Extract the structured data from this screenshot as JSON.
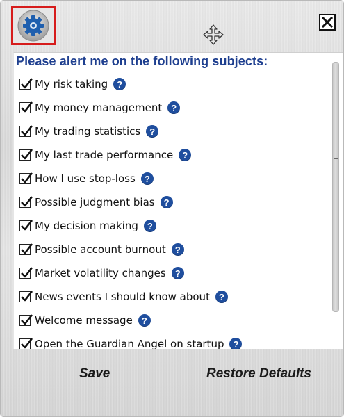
{
  "panel": {
    "title": "Please alert me on the following subjects:"
  },
  "subjects": [
    {
      "label": "My risk taking",
      "checked": true,
      "help": "?"
    },
    {
      "label": "My money management",
      "checked": true,
      "help": "?"
    },
    {
      "label": "My trading statistics",
      "checked": true,
      "help": "?"
    },
    {
      "label": "My last trade performance",
      "checked": true,
      "help": "?"
    },
    {
      "label": "How I use stop-loss",
      "checked": true,
      "help": "?"
    },
    {
      "label": "Possible judgment bias",
      "checked": true,
      "help": "?"
    },
    {
      "label": "My decision making",
      "checked": true,
      "help": "?"
    },
    {
      "label": "Possible account burnout",
      "checked": true,
      "help": "?"
    },
    {
      "label": "Market volatility changes",
      "checked": true,
      "help": "?"
    },
    {
      "label": "News events I should know about",
      "checked": true,
      "help": "?"
    },
    {
      "label": "Welcome message",
      "checked": true,
      "help": "?"
    },
    {
      "label": "Open the Guardian Angel on startup",
      "checked": true,
      "help": "?"
    }
  ],
  "footer": {
    "save_label": "Save",
    "restore_label": "Restore Defaults"
  },
  "icons": {
    "settings": "gear-icon",
    "close": "close-icon",
    "move": "move-icon",
    "check": "checkmark-icon",
    "help": "help-icon"
  },
  "colors": {
    "title": "#1e3f8f",
    "help_badge": "#1f4e9e",
    "settings_highlight": "#d61c1c",
    "gear": "#1f5fae"
  }
}
